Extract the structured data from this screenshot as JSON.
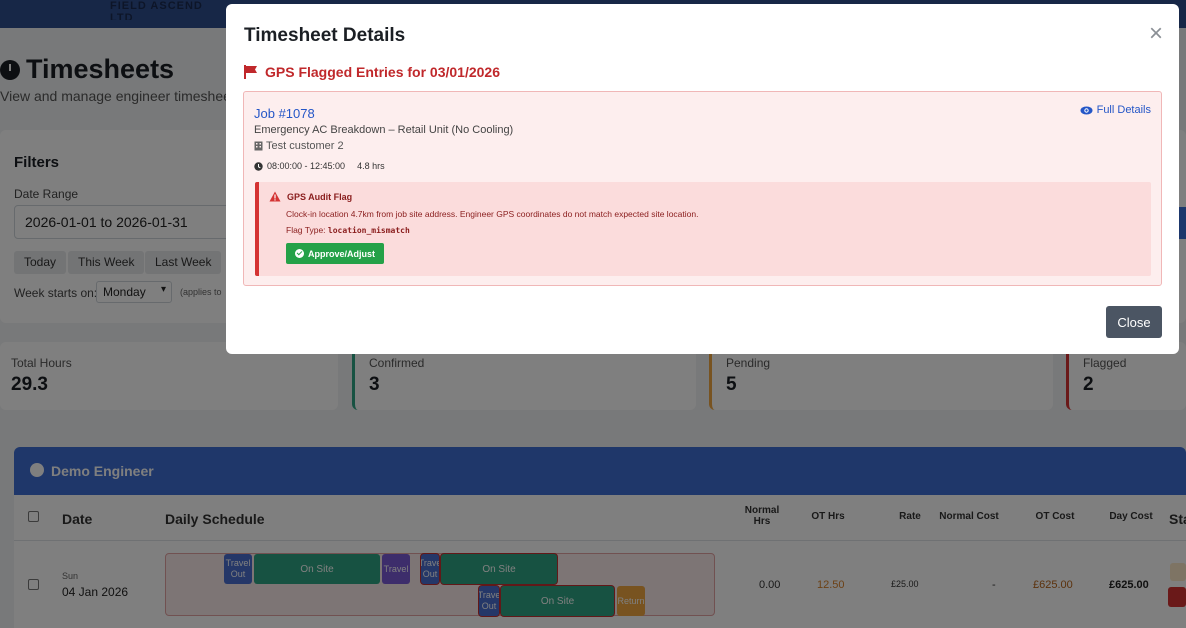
{
  "background": {
    "brand": "FIELD ASCEND LTD",
    "page_title": "Timesheets",
    "page_subtitle": "View and manage engineer timesheet en",
    "filters": {
      "title": "Filters",
      "date_range_label": "Date Range",
      "date_range_value": "2026-01-01 to 2026-01-31",
      "quick_buttons": [
        "Today",
        "This Week",
        "Last Week"
      ],
      "week_starts_label": "Week starts on:",
      "week_starts_value": "Monday",
      "week_starts_note": "(applies to"
    },
    "stats": [
      {
        "label": "Total Hours",
        "value": "29.3",
        "color": "#d8dde2"
      },
      {
        "label": "Confirmed",
        "value": "3",
        "color": "#2fa584"
      },
      {
        "label": "Pending",
        "value": "5",
        "color": "#f0a640"
      },
      {
        "label": "Flagged",
        "value": "2",
        "color": "#d43333"
      }
    ],
    "engineer": {
      "name": "Demo Engineer",
      "columns": {
        "date": "Date",
        "schedule": "Daily Schedule",
        "normal_hrs": "Normal Hrs",
        "ot_hrs": "OT Hrs",
        "rate": "Rate",
        "normal_cost": "Normal Cost",
        "ot_cost": "OT Cost",
        "day_cost": "Day Cost",
        "status": "Sta"
      },
      "row": {
        "day": "Sun",
        "date": "04 Jan 2026",
        "normal_hrs": "0.00",
        "ot_hrs": "12.50",
        "rate": "£25.00",
        "normal_cost": "-",
        "ot_cost": "£625.00",
        "day_cost": "£625.00",
        "segments": {
          "travel_out_1": "Travel Out",
          "on_site_1": "On Site",
          "travel": "Travel",
          "travel_out_2": "Trave Out",
          "on_site_2": "On Site",
          "travel_out_3": "Trave Out",
          "on_site_3": "On Site",
          "return": "Return"
        }
      }
    }
  },
  "modal": {
    "title": "Timesheet Details",
    "close_symbol": "×",
    "flag_heading": "GPS Flagged Entries for 03/01/2026",
    "entry": {
      "job_link": "Job #1078",
      "full_details": "Full Details",
      "description": "Emergency AC Breakdown – Retail Unit (No Cooling)",
      "customer": "Test customer 2",
      "time_range": "08:00:00 - 12:45:00",
      "hours": "4.8 hrs",
      "audit": {
        "title": "GPS Audit Flag",
        "message": "Clock-in location 4.7km from job site address. Engineer GPS coordinates do not match expected site location.",
        "flag_type_label": "Flag Type:",
        "flag_type_value": "location_mismatch",
        "approve_label": "Approve/Adjust"
      }
    },
    "close_button": "Close"
  },
  "colors": {
    "danger": "#c0282b",
    "link": "#2456c7",
    "success": "#24a148",
    "header_blue": "#3f6fd4"
  }
}
